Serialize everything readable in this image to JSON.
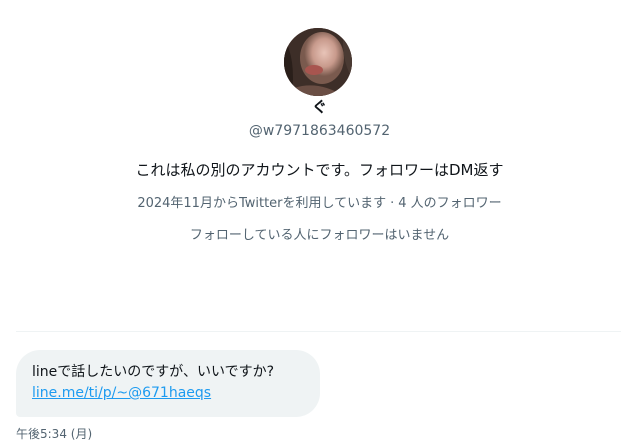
{
  "profile": {
    "display_name": "ぐ",
    "handle": "@w7971863460572",
    "bio": "これは私の別のアカウントです。フォロワーはDM返す",
    "joined": "2024年11月からTwitterを利用しています",
    "separator": "·",
    "followers": "4 人のフォロワー",
    "follow_note": "フォローしている人にフォロワーはいません"
  },
  "message": {
    "text": "lineで話したいのですが、いいですか?",
    "link": "line.me/ti/p/~@671haeqs",
    "timestamp": "午後5:34 (月)"
  },
  "colors": {
    "text": "#0f1419",
    "secondary": "#536471",
    "bubble": "#eff3f4",
    "link": "#1d9bf0"
  }
}
